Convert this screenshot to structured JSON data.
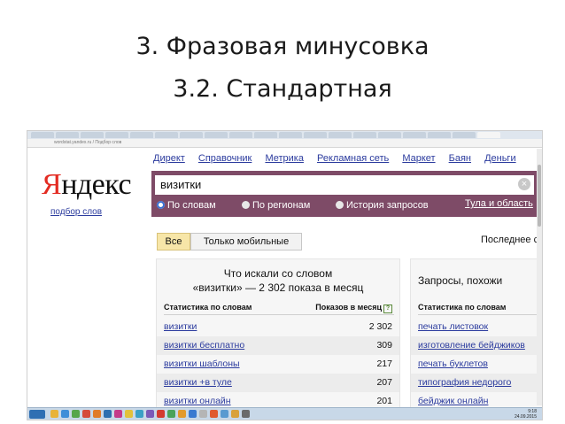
{
  "slide": {
    "title_line1": "3. Фразовая минусовка",
    "title_line2": "3.2. Стандартная"
  },
  "browser": {
    "url": "wordstat.yandex.ru",
    "tab_title": "Подбор слов"
  },
  "yandex": {
    "logo_ya": "Я",
    "logo_rest": "ндекс",
    "logo_sub": "подбор слов",
    "nav": [
      "Директ",
      "Справочник",
      "Метрика",
      "Рекламная сеть",
      "Маркет",
      "Баян",
      "Деньги"
    ],
    "search_value": "визитки",
    "clear_symbol": "×",
    "radios": [
      {
        "label": "По словам",
        "selected": true
      },
      {
        "label": "По регионам",
        "selected": false
      },
      {
        "label": "История запросов",
        "selected": false
      }
    ],
    "region": "Тула и область",
    "filter_buttons": [
      {
        "label": "Все",
        "active": true
      },
      {
        "label": "Только мобильные",
        "active": false
      }
    ],
    "last_label": "Последнее с",
    "left_panel": {
      "heading_line1": "Что искали со словом",
      "heading_line2": "«визитки» — 2 302 показа в месяц",
      "col1": "Статистика по словам",
      "col2": "Показов в месяц",
      "help": "?",
      "rows": [
        {
          "keyword": "визитки",
          "count": "2 302"
        },
        {
          "keyword": "визитки бесплатно",
          "count": "309"
        },
        {
          "keyword": "визитки шаблоны",
          "count": "217"
        },
        {
          "keyword": "визитки +в туле",
          "count": "207"
        },
        {
          "keyword": "визитки онлайн",
          "count": "201"
        }
      ]
    },
    "right_panel": {
      "heading": "Запросы, похожи",
      "col1": "Статистика по словам",
      "rows": [
        "печать листовок",
        "изготовление бейджиков",
        "печать буклетов",
        "типография недорого",
        "бейджик онлайн"
      ]
    }
  },
  "taskbar": {
    "time": "9:18",
    "date": "24.09.2015"
  },
  "colors": {
    "panel_purple": "#7e4b67",
    "link_blue": "#2b3b9e",
    "logo_red": "#e32b22",
    "active_button": "#f7e6a8"
  }
}
